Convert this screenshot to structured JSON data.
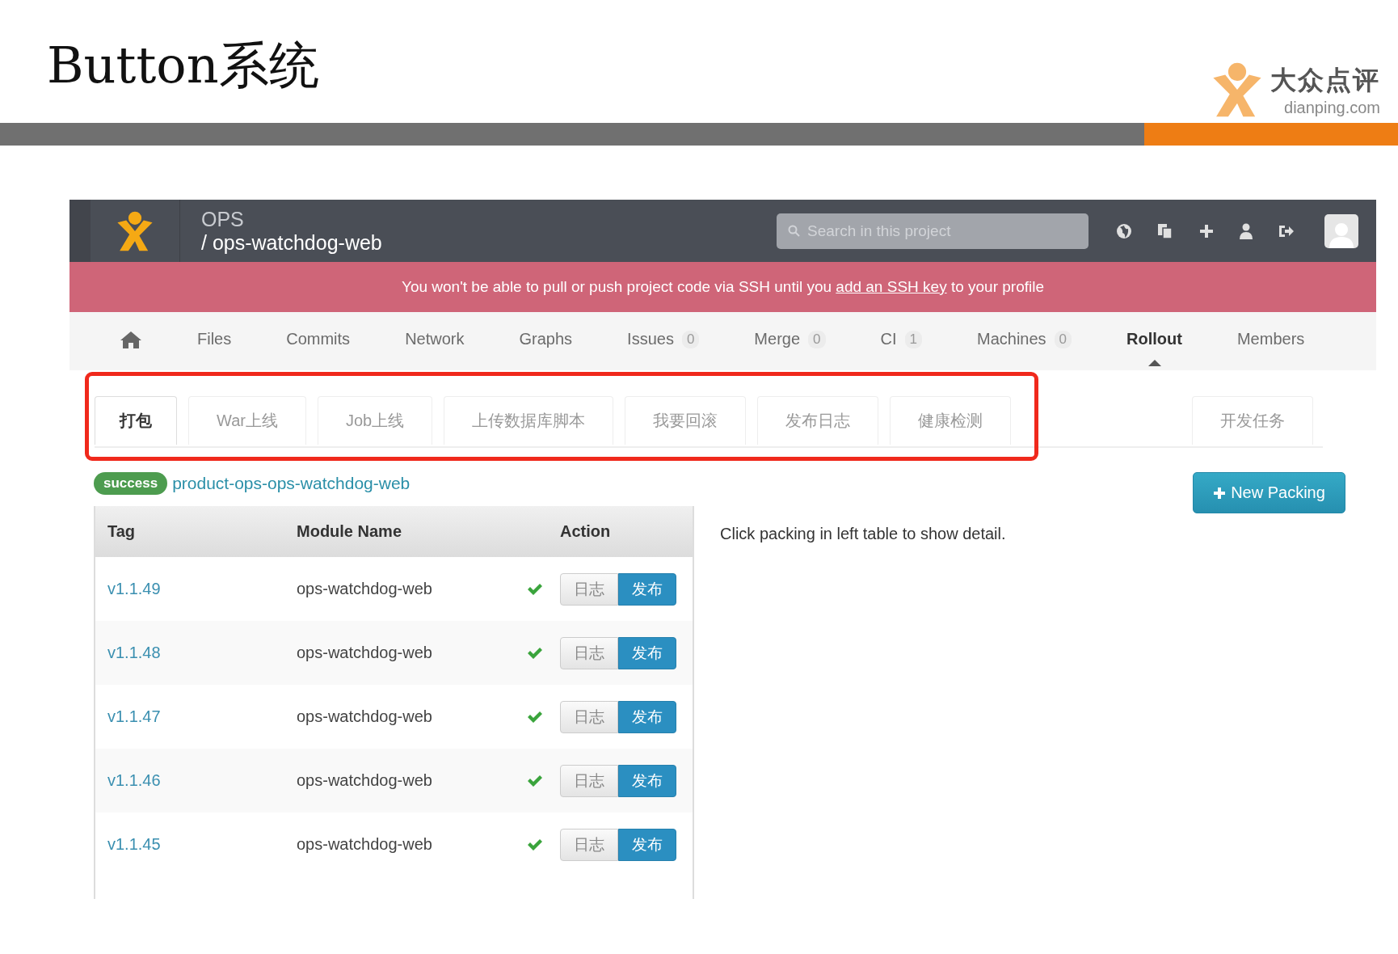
{
  "slide": {
    "title": "Button系统",
    "logo": {
      "name": "大众点评",
      "domain": "dianping.com"
    }
  },
  "header": {
    "group": "OPS",
    "separator": "/",
    "project": "ops-watchdog-web",
    "search": {
      "placeholder": "Search in this project"
    }
  },
  "alert": {
    "before": "You won't be able to pull or push project code via SSH until you",
    "link": "add an SSH key",
    "after": "to your profile"
  },
  "nav": [
    {
      "kind": "home",
      "selected": false
    },
    {
      "kind": "text",
      "label": "Files",
      "selected": false
    },
    {
      "kind": "text",
      "label": "Commits",
      "selected": false
    },
    {
      "kind": "text",
      "label": "Network",
      "selected": false
    },
    {
      "kind": "text",
      "label": "Graphs",
      "selected": false
    },
    {
      "kind": "text",
      "label": "Issues",
      "count": "0",
      "selected": false
    },
    {
      "kind": "text",
      "label": "Merge",
      "count": "0",
      "selected": false
    },
    {
      "kind": "text",
      "label": "CI",
      "count": "1",
      "selected": false
    },
    {
      "kind": "text",
      "label": "Machines",
      "count": "0",
      "selected": false
    },
    {
      "kind": "text",
      "label": "Rollout",
      "selected": true
    },
    {
      "kind": "text",
      "label": "Members",
      "selected": false
    }
  ],
  "tabs": [
    {
      "label": "打包",
      "selected": true
    },
    {
      "label": "War上线",
      "selected": false
    },
    {
      "label": "Job上线",
      "selected": false
    },
    {
      "label": "上传数据库脚本",
      "selected": false
    },
    {
      "label": "我要回滚",
      "selected": false
    },
    {
      "label": "发布日志",
      "selected": false
    },
    {
      "label": "健康检测",
      "selected": false
    }
  ],
  "tabs_right": [
    {
      "label": "开发任务",
      "selected": false
    }
  ],
  "build": {
    "status": "success",
    "name": "product-ops-ops-watchdog-web"
  },
  "new_button": {
    "label": "New Packing"
  },
  "table": {
    "columns": [
      "Tag",
      "Module Name",
      "Action"
    ],
    "rows": [
      {
        "tag": "v1.1.49",
        "module": "ops-watchdog-web",
        "ok": true,
        "actions": [
          "日志",
          "发布"
        ]
      },
      {
        "tag": "v1.1.48",
        "module": "ops-watchdog-web",
        "ok": true,
        "actions": [
          "日志",
          "发布"
        ]
      },
      {
        "tag": "v1.1.47",
        "module": "ops-watchdog-web",
        "ok": true,
        "actions": [
          "日志",
          "发布"
        ]
      },
      {
        "tag": "v1.1.46",
        "module": "ops-watchdog-web",
        "ok": true,
        "actions": [
          "日志",
          "发布"
        ]
      },
      {
        "tag": "v1.1.45",
        "module": "ops-watchdog-web",
        "ok": true,
        "actions": [
          "日志",
          "发布"
        ]
      }
    ]
  },
  "detail_hint": "Click packing in left table to show detail."
}
